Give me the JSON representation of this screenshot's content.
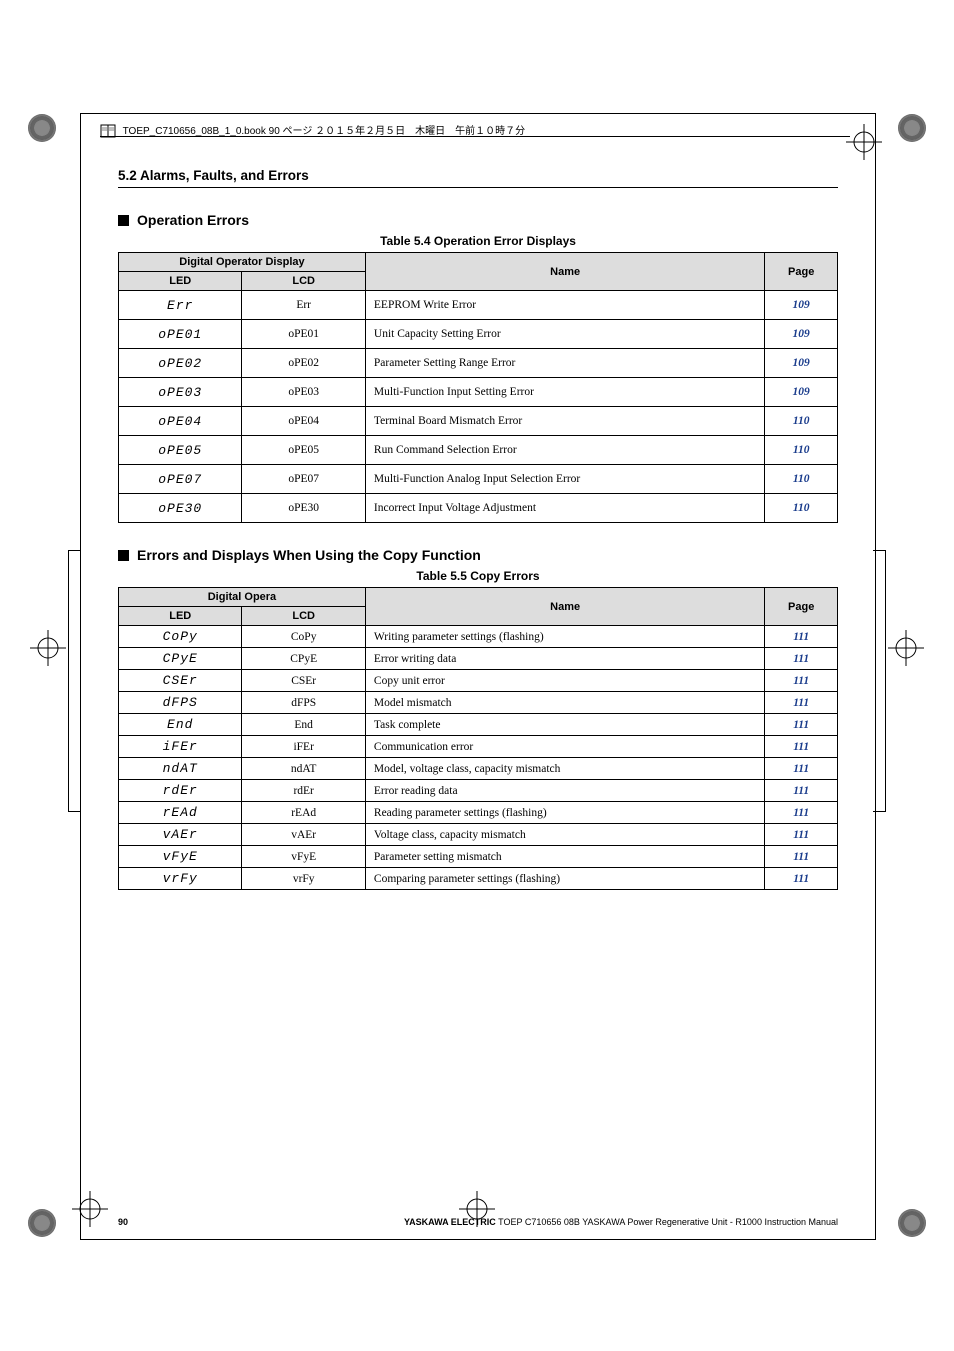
{
  "header_line": "TOEP_C710656_08B_1_0.book  90 ページ  ２０１５年２月５日　木曜日　午前１０時７分",
  "breadcrumb": "5.2  Alarms, Faults, and Errors",
  "section1": "Operation Errors",
  "caption1": "Table 5.4  Operation Error Displays",
  "section2": "Errors and Displays When Using the Copy Function",
  "caption2": "Table 5.5  Copy Errors",
  "th": {
    "dod": "Digital Operator Display",
    "dod2": "Digital Opera",
    "led": "LED",
    "lcd": "LCD",
    "name": "Name",
    "page": "Page"
  },
  "t1": {
    "rows": [
      {
        "led": "Err",
        "lcd": "Err",
        "name": "EEPROM Write Error",
        "page": "109"
      },
      {
        "led": "oPE01",
        "lcd": "oPE01",
        "name": "Unit Capacity Setting Error",
        "page": "109"
      },
      {
        "led": "oPE02",
        "lcd": "oPE02",
        "name": "Parameter Setting Range Error",
        "page": "109"
      },
      {
        "led": "oPE03",
        "lcd": "oPE03",
        "name": "Multi-Function Input Setting Error",
        "page": "109"
      },
      {
        "led": "oPE04",
        "lcd": "oPE04",
        "name": "Terminal Board Mismatch Error",
        "page": "110"
      },
      {
        "led": "oPE05",
        "lcd": "oPE05",
        "name": "Run Command Selection Error",
        "page": "110"
      },
      {
        "led": "oPE07",
        "lcd": "oPE07",
        "name": "Multi-Function Analog Input Selection Error",
        "page": "110"
      },
      {
        "led": "oPE30",
        "lcd": "oPE30",
        "name": "Incorrect Input Voltage Adjustment",
        "page": "110"
      }
    ]
  },
  "t2": {
    "rows": [
      {
        "led": "CoPy",
        "lcd": "CoPy",
        "name": "Writing parameter settings (flashing)",
        "page": "111"
      },
      {
        "led": "CPyE",
        "lcd": "CPyE",
        "name": "Error writing data",
        "page": "111"
      },
      {
        "led": "CSEr",
        "lcd": "CSEr",
        "name": "Copy unit error",
        "page": "111"
      },
      {
        "led": "dFPS",
        "lcd": "dFPS",
        "name": "Model mismatch",
        "page": "111"
      },
      {
        "led": "End",
        "lcd": "End",
        "name": "Task complete",
        "page": "111"
      },
      {
        "led": "iFEr",
        "lcd": "iFEr",
        "name": "Communication error",
        "page": "111"
      },
      {
        "led": "ndAT",
        "lcd": "ndAT",
        "name": "Model, voltage class, capacity mismatch",
        "page": "111"
      },
      {
        "led": "rdEr",
        "lcd": "rdEr",
        "name": "Error reading data",
        "page": "111"
      },
      {
        "led": "rEAd",
        "lcd": "rEAd",
        "name": "Reading parameter settings (flashing)",
        "page": "111"
      },
      {
        "led": "vAEr",
        "lcd": "vAEr",
        "name": "Voltage class, capacity mismatch",
        "page": "111"
      },
      {
        "led": "vFyE",
        "lcd": "vFyE",
        "name": "Parameter setting mismatch",
        "page": "111"
      },
      {
        "led": "vrFy",
        "lcd": "vrFy",
        "name": "Comparing parameter settings (flashing)",
        "page": "111"
      }
    ]
  },
  "footer": {
    "page": "90",
    "text_bold": "YASKAWA ELECTRIC",
    "text_rest": " TOEP C710656 08B YASKAWA Power Regenerative Unit - R1000 Instruction Manual"
  }
}
